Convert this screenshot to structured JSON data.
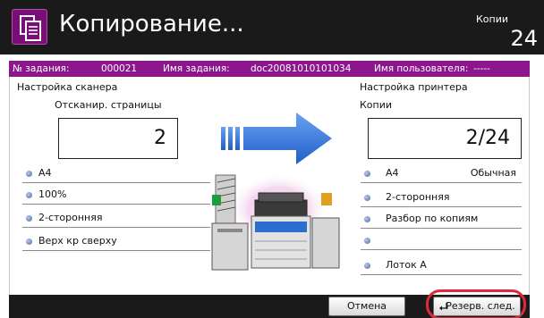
{
  "header": {
    "title": "Копирование...",
    "copies_label": "Копии",
    "copies_value": "24",
    "icon": "copy-document-icon"
  },
  "job": {
    "number_label": "№ задания:",
    "number_value": "000021",
    "name_label": "Имя задания:",
    "name_value": "doc20081010101034",
    "user_label": "Имя пользователя:",
    "user_value": "-----"
  },
  "scanner": {
    "title": "Настройка сканера",
    "pages_label": "Отсканир. страницы",
    "pages_value": "2",
    "settings": [
      "A4",
      "100%",
      "2-сторонняя",
      "Верх кр сверху"
    ]
  },
  "printer": {
    "title": "Настройка принтера",
    "copies_label": "Копии",
    "copies_value": "2/24",
    "settings": [
      {
        "label": "A4",
        "extra": "Обычная"
      },
      {
        "label": "2-сторонняя",
        "extra": ""
      },
      {
        "label": "Разбор по копиям",
        "extra": ""
      },
      {
        "label": "",
        "extra": ""
      },
      {
        "label": "Лоток A",
        "extra": ""
      }
    ]
  },
  "buttons": {
    "cancel": "Отмена",
    "reserve_next": "Резерв. след."
  },
  "colors": {
    "accent": "#8d168c",
    "header_bg": "#1a1a1a",
    "arrow": "#2f6fd8",
    "highlight": "#e0293b"
  }
}
